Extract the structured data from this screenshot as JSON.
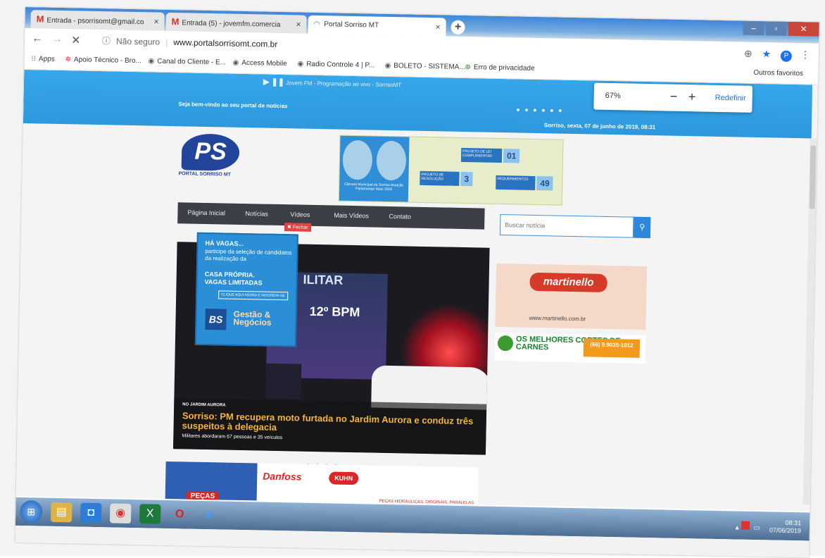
{
  "browser": {
    "tabs": [
      {
        "label": "Entrada - psorrisomt@gmail.co",
        "icon": "gmail-icon"
      },
      {
        "label": "Entrada (5) - jovemfm.comercia",
        "icon": "gmail-icon"
      },
      {
        "label": "Portal Sorriso MT",
        "icon": "loading-icon"
      }
    ],
    "new_tab_label": "+",
    "close_glyph": "×",
    "security": "Não seguro",
    "url": "www.portalsorrisomt.com.br",
    "avatar_letter": "P"
  },
  "bookmarks": [
    {
      "label": "Apps",
      "icon": "apps-icon"
    },
    {
      "label": "Apoio Técnico - Bro...",
      "icon": "apoio-icon"
    },
    {
      "label": "Canal do Cliente - E...",
      "icon": "globe-icon"
    },
    {
      "label": "Access Mobile",
      "icon": "globe-icon"
    },
    {
      "label": "Radio Controle 4 | P...",
      "icon": "globe-icon"
    },
    {
      "label": "BOLETO - SISTEMA...",
      "icon": "globe-icon"
    },
    {
      "label": "Erro de privacidade",
      "icon": "warning-icon"
    }
  ],
  "other_bookmarks": "Outros favoritos",
  "zoom": {
    "value": "67%",
    "minus": "−",
    "plus": "+",
    "reset": "Redefinir"
  },
  "site": {
    "radio_text": "Jovem FM - Programação ao vivo - SorrisoMT",
    "welcome": "Seja bem-vindo ao seu portal de notícias",
    "date": "Sorriso, sexta, 07 de junho de 2019, 08:31",
    "logo_letters": "PS",
    "logo_name": "PORTAL SORRISO MT",
    "council_text": "Câmara Municipal de Sorriso Atuação Parlamentar Maio 2019",
    "stats": [
      {
        "label": "PROJETO DE LEI COMPLEMENTAR",
        "value": "01"
      },
      {
        "label": "PROJETO DE RESOLUÇÃO",
        "value": "3"
      },
      {
        "label": "REQUERIMENTOS",
        "value": "49"
      }
    ],
    "nav": [
      "Página Inicial",
      "Notícias",
      "Vídeos",
      "Mais Vídeos",
      "Contato"
    ],
    "close_ad": "✖ Fechar",
    "search_placeholder": "Buscar notícia",
    "hero": {
      "sign1": "ILITAR",
      "sign2": "12º BPM",
      "kicker": "NO JARDIM AURORA",
      "headline": "Sorriso: PM recupera moto furtada no Jardim Aurora e conduz três suspeitos à delegacia",
      "sub": "Militares abordaram 67 pessoas e 35 veículos"
    },
    "popup_ad": {
      "title": "HÁ VAGAS...",
      "text": "participe da seleção de candidatos da realização da",
      "line1": "CASA PRÓPRIA.",
      "line2": "VAGAS LIMITADAS",
      "cta": "CLIQUE AQUI AGORA E INSCREVA-SE",
      "logo": "BS",
      "brand": "Gestão & Negócios"
    },
    "ad_martinello": {
      "brand": "martinello",
      "url": "www.martinello.com.br"
    },
    "ad_meat": {
      "headline": "OS MELHORES CORTES DE CARNES",
      "phone": "(66) 9.9035-1812"
    },
    "bottom_ad": {
      "pecas": "PEÇAS",
      "danfoss": "Danfoss",
      "kuhn": "KUHN",
      "text": "PEÇAS HIDRÁULICAS, ORIGINAIS, PARALELAS OU REMANUFATURADAS"
    }
  },
  "taskbar": {
    "time": "08:31",
    "date": "07/06/2019"
  }
}
